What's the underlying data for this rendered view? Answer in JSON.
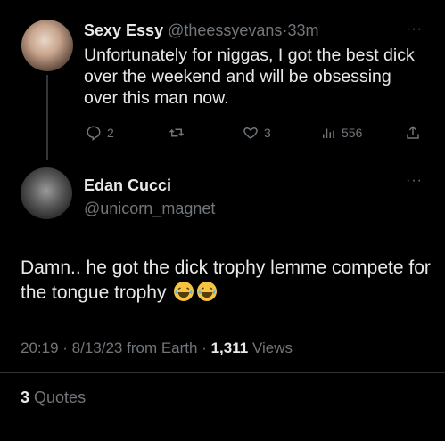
{
  "tweet1": {
    "display_name": "Sexy Essy",
    "handle": "@theessyevans",
    "separator": "·",
    "time": "33m",
    "text": "Unfortunately for niggas, I got the best dick over the weekend and will be obsessing over this man now.",
    "replies": "2",
    "retweets": "",
    "likes": "3",
    "views": "556"
  },
  "tweet2": {
    "display_name": "Edan Cucci",
    "handle": "@unicorn_magnet",
    "text": "Damn.. he got the dick trophy lemme compete for the tongue trophy",
    "time": "20:19",
    "date": "8/13/23",
    "location": "from Earth",
    "views_count": "1,311",
    "views_label": "Views",
    "quotes_count": "3",
    "quotes_label": "Quotes"
  },
  "icons": [
    "reply-icon",
    "retweet-icon",
    "like-icon",
    "views-icon",
    "share-icon",
    "more-icon",
    "laughing-emoji"
  ],
  "colors": {
    "background": "#000000",
    "text": "#e7e9ea",
    "muted": "#71767b",
    "divider": "#2f3336"
  }
}
